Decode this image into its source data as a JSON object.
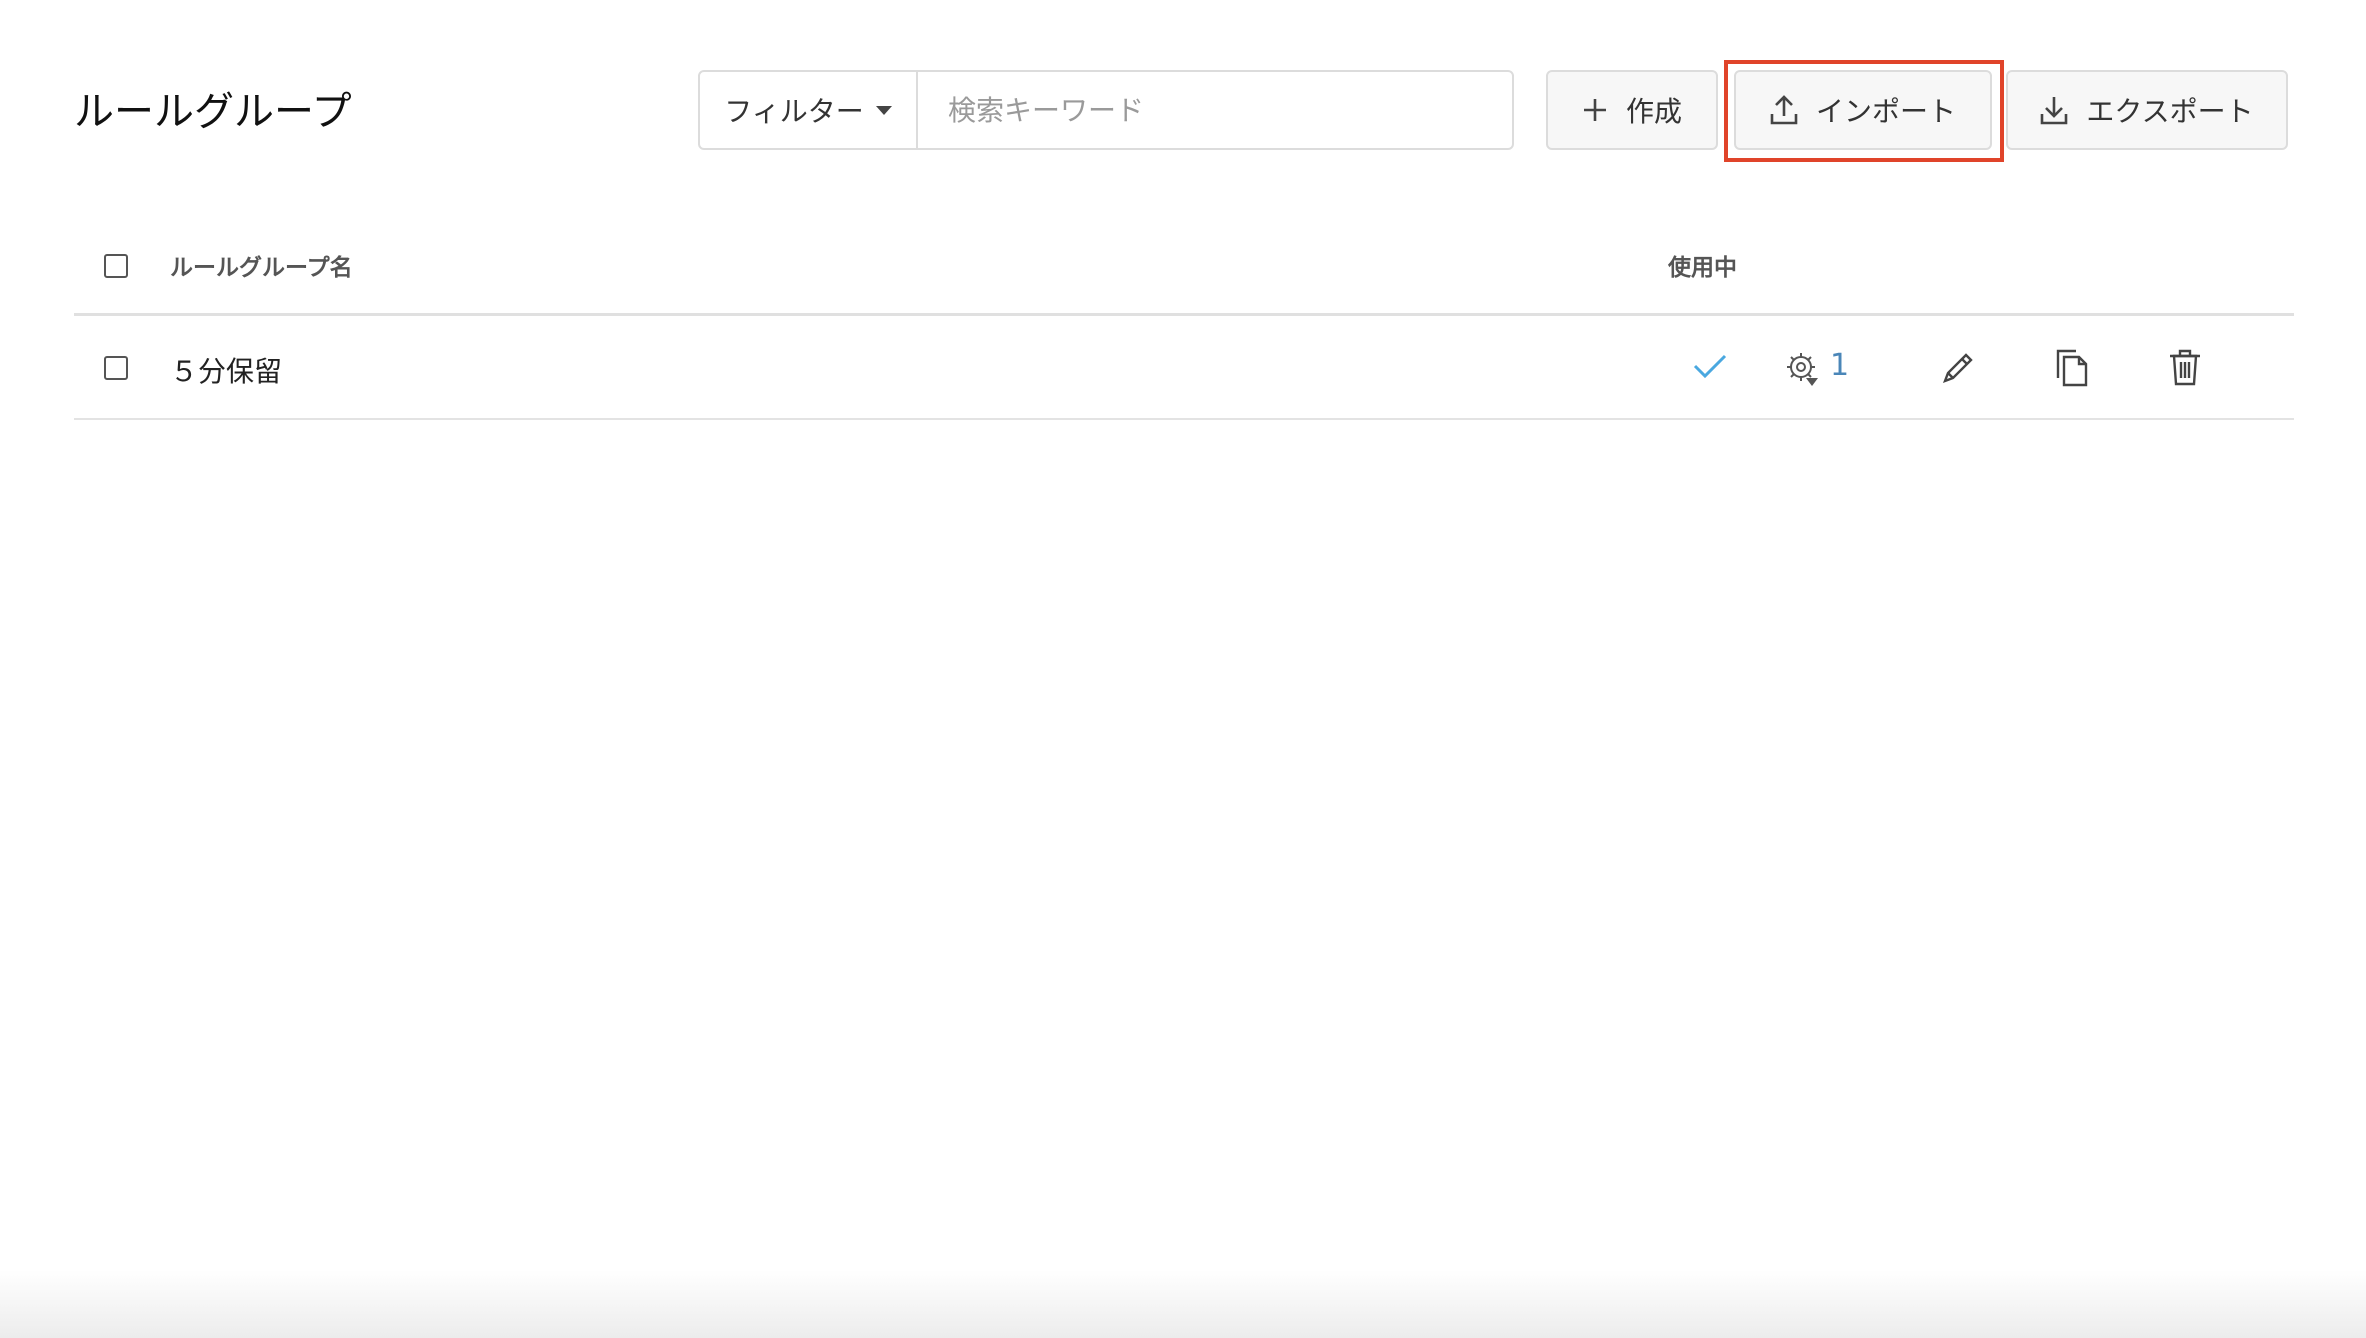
{
  "header": {
    "title": "ルールグループ",
    "filter_label": "フィルター",
    "search_placeholder": "検索キーワード",
    "create_label": "作成",
    "import_label": "インポート",
    "export_label": "エクスポート"
  },
  "table": {
    "columns": {
      "name": "ルールグループ名",
      "in_use": "使用中"
    },
    "rows": [
      {
        "name": "５分保留",
        "in_use": true,
        "rule_count": "1"
      }
    ]
  },
  "icons": {
    "create": "plus-icon",
    "import": "upload-icon",
    "export": "download-icon",
    "in_use": "check-icon",
    "rules": "gear-icon",
    "edit": "pencil-icon",
    "copy": "copy-icon",
    "delete": "trash-icon"
  },
  "colors": {
    "highlight": "#e0442a",
    "check": "#4aa8e0",
    "count": "#4a86b8"
  }
}
